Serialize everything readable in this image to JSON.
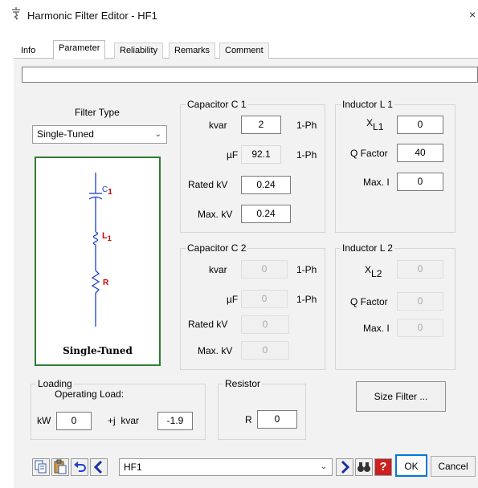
{
  "window": {
    "title": "Harmonic Filter Editor - HF1",
    "close_glyph": "×"
  },
  "tabs": [
    {
      "label": "Info"
    },
    {
      "label": "Parameter"
    },
    {
      "label": "Reliability"
    },
    {
      "label": "Remarks"
    },
    {
      "label": "Comment"
    }
  ],
  "active_tab": "Parameter",
  "filter_type": {
    "label": "Filter Type",
    "selected": "Single-Tuned",
    "diagram_caption": "Single-Tuned",
    "labels": {
      "c_main": "C",
      "c_sub": "1",
      "l_main": "L",
      "l_sub": "1",
      "r": "R"
    }
  },
  "capacitor_c1": {
    "title": "Capacitor C 1",
    "kvar_label": "kvar",
    "kvar": "2",
    "kvar_unit": "1-Ph",
    "uf_label": "µF",
    "uf": "92.1",
    "uf_unit": "1-Ph",
    "rated_kv_label": "Rated kV",
    "rated_kv": "0.24",
    "max_kv_label": "Max. kV",
    "max_kv": "0.24"
  },
  "capacitor_c2": {
    "title": "Capacitor C 2",
    "kvar_label": "kvar",
    "kvar": "0",
    "kvar_unit": "1-Ph",
    "uf_label": "µF",
    "uf": "0",
    "uf_unit": "1-Ph",
    "rated_kv_label": "Rated kV",
    "rated_kv": "0",
    "max_kv_label": "Max. kV",
    "max_kv": "0"
  },
  "inductor_l1": {
    "title": "Inductor L 1",
    "x_label_main": "X",
    "x_label_sub": "L1",
    "x": "0",
    "q_label": "Q Factor",
    "q": "40",
    "max_i_label": "Max. I",
    "max_i": "0"
  },
  "inductor_l2": {
    "title": "Inductor L 2",
    "x_label_main": "X",
    "x_label_sub": "L2",
    "x": "0",
    "q_label": "Q Factor",
    "q": "0",
    "max_i_label": "Max. I",
    "max_i": "0"
  },
  "loading": {
    "title": "Loading",
    "sub_label": "Operating Load:",
    "kw_label": "kW",
    "kw": "0",
    "kvar_label": "+j  kvar",
    "kvar": "-1.9"
  },
  "resistor": {
    "title": "Resistor",
    "r_label": "R",
    "r": "0"
  },
  "size_filter_label": "Size Filter ...",
  "bottom": {
    "id_value": "HF1",
    "ok_label": "OK",
    "cancel_label": "Cancel",
    "help_glyph": "?"
  },
  "colors": {
    "diagram_border": "#2e7d32",
    "circuit_blue": "#1f3fd0",
    "circuit_red": "#cc0000",
    "ok_border": "#0078d7"
  }
}
